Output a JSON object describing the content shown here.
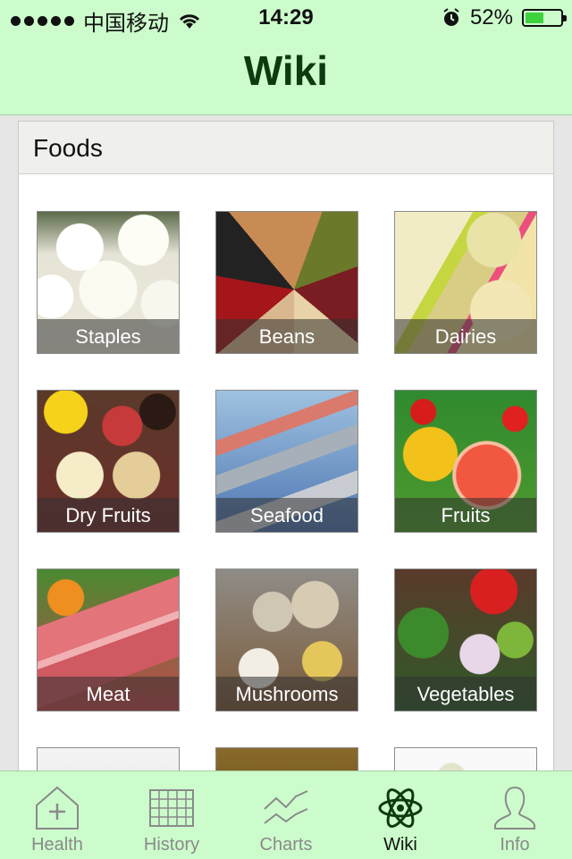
{
  "status_bar": {
    "carrier": "中国移动",
    "time": "14:29",
    "battery_percent": "52%",
    "battery_level": 0.52
  },
  "nav": {
    "title": "Wiki"
  },
  "section": {
    "title": "Foods",
    "items": [
      {
        "label": "Staples",
        "image": "staples"
      },
      {
        "label": "Beans",
        "image": "beans"
      },
      {
        "label": "Dairies",
        "image": "dairies"
      },
      {
        "label": "Dry Fruits",
        "image": "dryfruits"
      },
      {
        "label": "Seafood",
        "image": "seafood"
      },
      {
        "label": "Fruits",
        "image": "fruits"
      },
      {
        "label": "Meat",
        "image": "meat"
      },
      {
        "label": "Mushrooms",
        "image": "mushrooms"
      },
      {
        "label": "Vegetables",
        "image": "vegetables"
      }
    ],
    "partial_items": [
      {
        "image": "eggs"
      },
      {
        "image": "spices"
      },
      {
        "image": "drinks"
      }
    ]
  },
  "tabs": [
    {
      "label": "Health",
      "icon": "health-icon",
      "active": false
    },
    {
      "label": "History",
      "icon": "history-icon",
      "active": false
    },
    {
      "label": "Charts",
      "icon": "charts-icon",
      "active": false
    },
    {
      "label": "Wiki",
      "icon": "atom-icon",
      "active": true
    },
    {
      "label": "Info",
      "icon": "person-icon",
      "active": false
    }
  ],
  "colors": {
    "bar_background": "#ccfccc",
    "title_color": "#0f3a10",
    "battery_fill": "#3ed23e"
  }
}
